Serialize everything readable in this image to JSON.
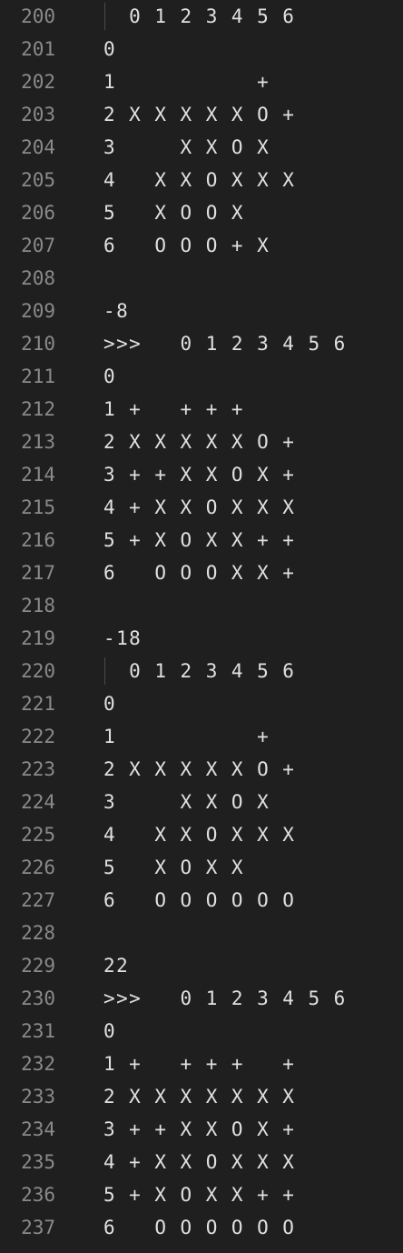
{
  "editor": {
    "lines": [
      {
        "num": "200",
        "text": "  0 1 2 3 4 5 6",
        "guide": true
      },
      {
        "num": "201",
        "text": "0",
        "guide": false
      },
      {
        "num": "202",
        "text": "1           +",
        "guide": false
      },
      {
        "num": "203",
        "text": "2 X X X X X O +",
        "guide": false
      },
      {
        "num": "204",
        "text": "3     X X O X",
        "guide": false
      },
      {
        "num": "205",
        "text": "4   X X O X X X",
        "guide": false
      },
      {
        "num": "206",
        "text": "5   X O O X",
        "guide": false
      },
      {
        "num": "207",
        "text": "6   O O O + X",
        "guide": false
      },
      {
        "num": "208",
        "text": "",
        "guide": false
      },
      {
        "num": "209",
        "text": "-8",
        "guide": false
      },
      {
        "num": "210",
        "text": ">>>   0 1 2 3 4 5 6",
        "guide": false
      },
      {
        "num": "211",
        "text": "0",
        "guide": false
      },
      {
        "num": "212",
        "text": "1 +   + + +",
        "guide": false
      },
      {
        "num": "213",
        "text": "2 X X X X X O +",
        "guide": false
      },
      {
        "num": "214",
        "text": "3 + + X X O X +",
        "guide": false
      },
      {
        "num": "215",
        "text": "4 + X X O X X X",
        "guide": false
      },
      {
        "num": "216",
        "text": "5 + X O X X + +",
        "guide": false
      },
      {
        "num": "217",
        "text": "6   O O O X X +",
        "guide": false
      },
      {
        "num": "218",
        "text": "",
        "guide": false
      },
      {
        "num": "219",
        "text": "-18",
        "guide": false
      },
      {
        "num": "220",
        "text": "  0 1 2 3 4 5 6",
        "guide": true
      },
      {
        "num": "221",
        "text": "0",
        "guide": false
      },
      {
        "num": "222",
        "text": "1           +",
        "guide": false
      },
      {
        "num": "223",
        "text": "2 X X X X X O +",
        "guide": false
      },
      {
        "num": "224",
        "text": "3     X X O X",
        "guide": false
      },
      {
        "num": "225",
        "text": "4   X X O X X X",
        "guide": false
      },
      {
        "num": "226",
        "text": "5   X O X X",
        "guide": false
      },
      {
        "num": "227",
        "text": "6   O O O O O O",
        "guide": false
      },
      {
        "num": "228",
        "text": "",
        "guide": false
      },
      {
        "num": "229",
        "text": "22",
        "guide": false
      },
      {
        "num": "230",
        "text": ">>>   0 1 2 3 4 5 6",
        "guide": false
      },
      {
        "num": "231",
        "text": "0",
        "guide": false
      },
      {
        "num": "232",
        "text": "1 +   + + +   +",
        "guide": false
      },
      {
        "num": "233",
        "text": "2 X X X X X X X",
        "guide": false
      },
      {
        "num": "234",
        "text": "3 + + X X O X +",
        "guide": false
      },
      {
        "num": "235",
        "text": "4 + X X O X X X",
        "guide": false
      },
      {
        "num": "236",
        "text": "5 + X O X X + +",
        "guide": false
      },
      {
        "num": "237",
        "text": "6   O O O O O O",
        "guide": false
      }
    ]
  }
}
